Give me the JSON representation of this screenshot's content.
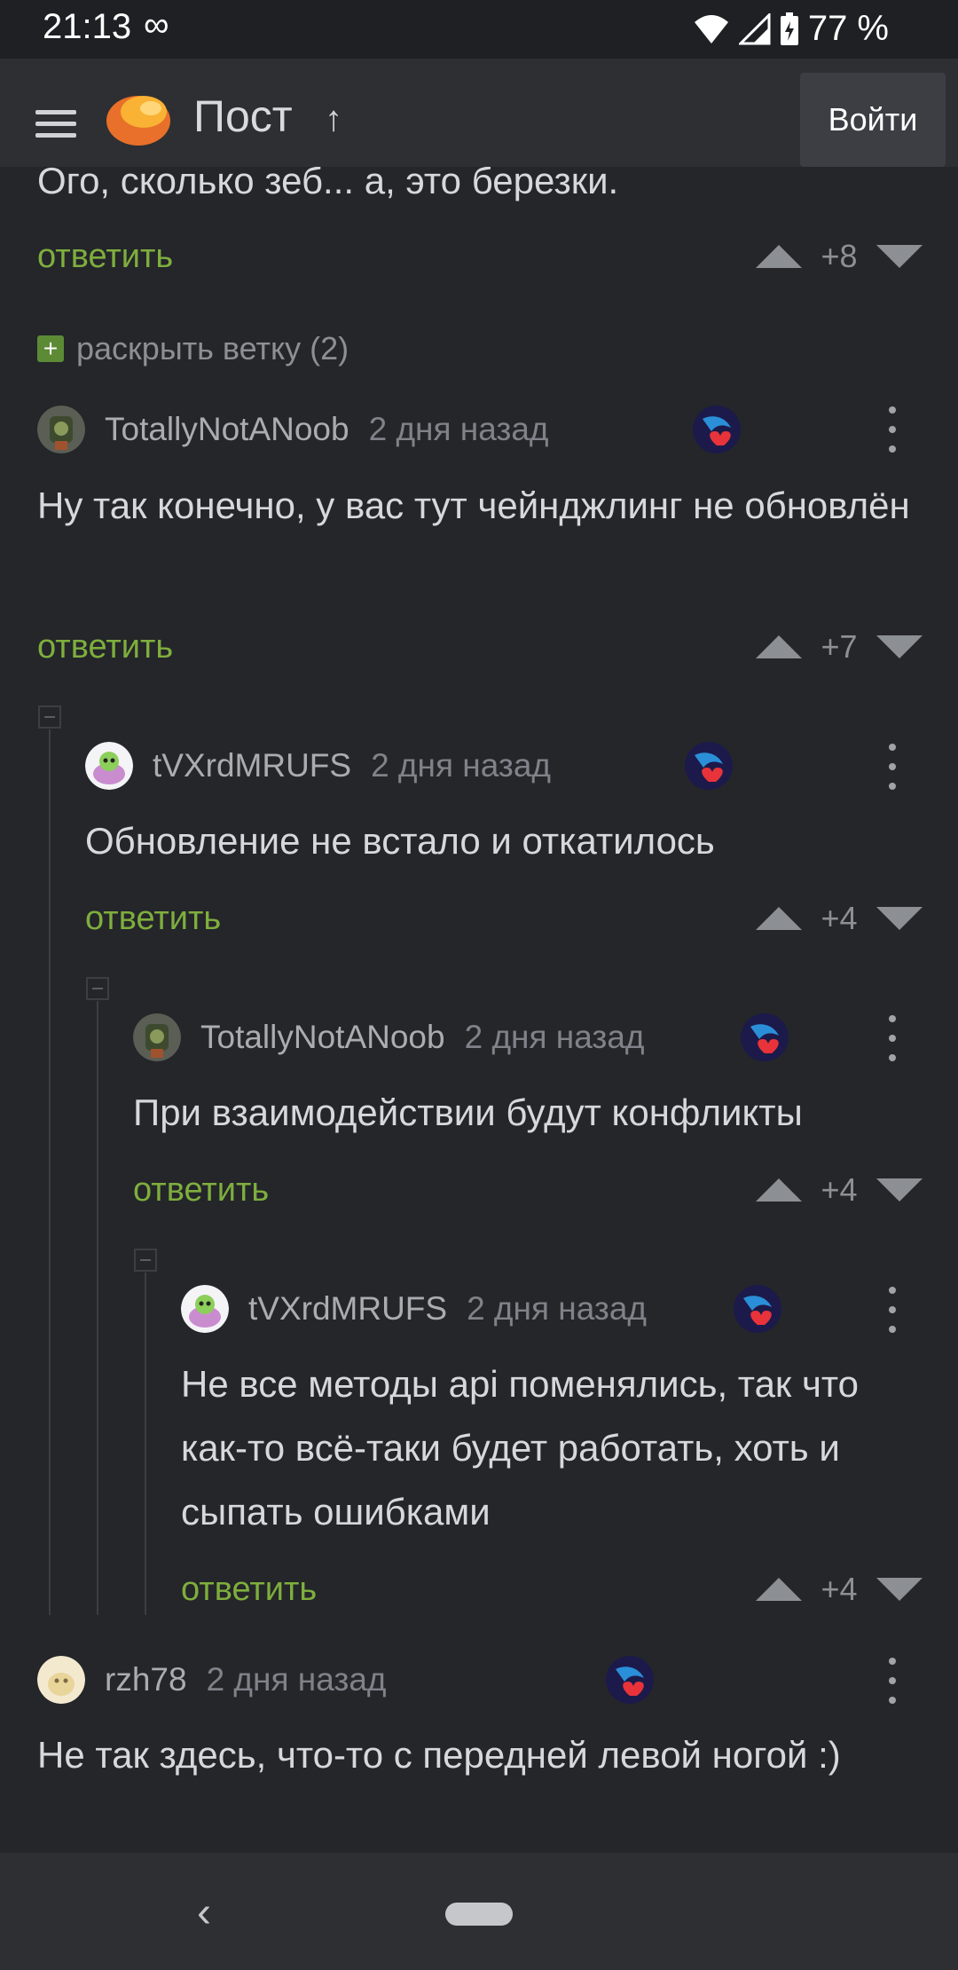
{
  "status_bar": {
    "time": "21:13",
    "infinity": "∞",
    "battery": "77 %"
  },
  "app_bar": {
    "title": "Пост",
    "title_arrow": "↑",
    "login": "Войти"
  },
  "cut_text": "Ого, сколько зеб... а, это березки.",
  "reply_label": "ответить",
  "expand_thread": "раскрыть ветку (2)",
  "comments": [
    {
      "score": "+8"
    },
    {
      "author": "TotallyNotANoob",
      "ago": "2 дня назад",
      "text": "Ну так конечно, у вас тут чейнджлинг не обновлён",
      "score": "+7"
    },
    {
      "author": "tVXrdMRUFS",
      "ago": "2 дня назад",
      "text": "Обновление не встало и откатилось",
      "score": "+4"
    },
    {
      "author": "TotallyNotANoob",
      "ago": "2 дня назад",
      "text": "При взаимодействии будут конфликты",
      "score": "+4"
    },
    {
      "author": "tVXrdMRUFS",
      "ago": "2 дня назад",
      "text": "Не все методы api поменялись, так что как-то всё-таки будет работать, хоть и сыпать ошибками",
      "score": "+4"
    },
    {
      "author": "rzh78",
      "ago": "2 дня назад",
      "text": "Не так здесь, что-то с передней левой ногой :)"
    }
  ],
  "nav": {
    "back": "‹"
  }
}
